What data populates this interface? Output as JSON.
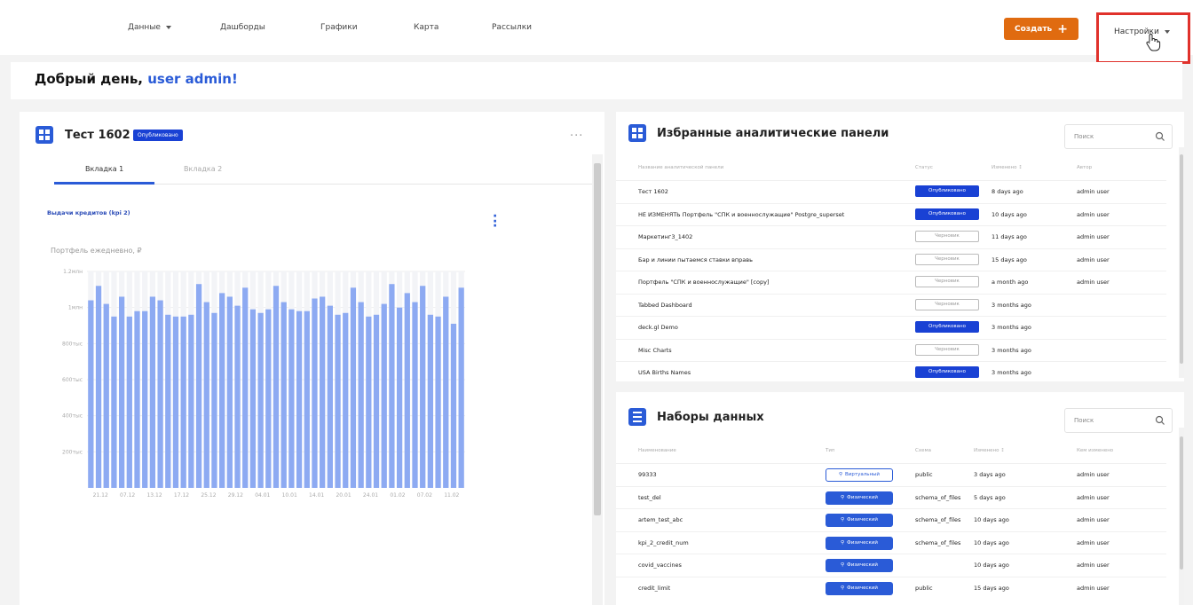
{
  "nav": {
    "items": [
      {
        "label": "Данные",
        "dropdown": true
      },
      {
        "label": "Дашборды"
      },
      {
        "label": "Графики"
      },
      {
        "label": "Карта"
      },
      {
        "label": "Рассылки"
      }
    ],
    "create_label": "Создать",
    "settings_label": "Настройки"
  },
  "greeting": {
    "prefix": "Добрый день,",
    "user": "user admin!"
  },
  "dashboard": {
    "title": "Тест 1602",
    "status": "Опубликовано",
    "more": "···",
    "tabs": [
      "Вкладка 1",
      "Вкладка 2"
    ],
    "chart_title": "Выдачи кредитов (kpi 2)",
    "chart_subtitle": "Портфель ежедневно, ₽"
  },
  "chart_data": {
    "type": "bar",
    "y_ticks": [
      "1.2млн",
      "1млн",
      "800тыс",
      "600тыс",
      "400тыс",
      "200тыс"
    ],
    "ylim": [
      0,
      1200000
    ],
    "x_ticks": [
      "21.12",
      "07.12",
      "13.12",
      "17.12",
      "25.12",
      "29.12",
      "04.01",
      "10.01",
      "14.01",
      "20.01",
      "24.01",
      "01.02",
      "07.02",
      "11.02"
    ],
    "values": [
      1040000,
      1120000,
      1020000,
      950000,
      1060000,
      950000,
      980000,
      980000,
      1060000,
      1040000,
      960000,
      950000,
      950000,
      960000,
      1130000,
      1030000,
      970000,
      1080000,
      1060000,
      1010000,
      1110000,
      990000,
      970000,
      990000,
      1120000,
      1030000,
      990000,
      980000,
      980000,
      1050000,
      1060000,
      1010000,
      960000,
      970000,
      1110000,
      1030000,
      950000,
      960000,
      1020000,
      1130000,
      1000000,
      1080000,
      1030000,
      1120000,
      960000,
      950000,
      1060000,
      910000,
      1110000
    ],
    "color": "#8daaf2",
    "grid": true
  },
  "favorites": {
    "title": "Избранные аналитические панели",
    "search_placeholder": "Поиск",
    "columns": [
      "Название аналитической панели",
      "Статус",
      "Изменено",
      "Автор"
    ],
    "sort_glyph": "↕",
    "rows": [
      {
        "name": "Тест 1602",
        "status": "Опубликовано",
        "published": true,
        "modified": "8 days ago",
        "author": "admin user"
      },
      {
        "name": "НЕ ИЗМЕНЯТЬ Портфель \"СПК и военнослужащие\" Postgre_superset",
        "status": "Опубликовано",
        "published": true,
        "modified": "10 days ago",
        "author": "admin user"
      },
      {
        "name": "Маркетинг3_1402",
        "status": "Черновик",
        "published": false,
        "modified": "11 days ago",
        "author": "admin user"
      },
      {
        "name": "Бар и линии пытаемся ставки вправь",
        "status": "Черновик",
        "published": false,
        "modified": "15 days ago",
        "author": "admin user"
      },
      {
        "name": "Портфель \"СПК и военнослужащие\" [copy]",
        "status": "Черновик",
        "published": false,
        "modified": "a month ago",
        "author": "admin user"
      },
      {
        "name": "Tabbed Dashboard",
        "status": "Черновик",
        "published": false,
        "modified": "3 months ago",
        "author": ""
      },
      {
        "name": "deck.gl Demo",
        "status": "Опубликовано",
        "published": true,
        "modified": "3 months ago",
        "author": ""
      },
      {
        "name": "Misc Charts",
        "status": "Черновик",
        "published": false,
        "modified": "3 months ago",
        "author": ""
      },
      {
        "name": "USA Births Names",
        "status": "Опубликовано",
        "published": true,
        "modified": "3 months ago",
        "author": ""
      }
    ]
  },
  "datasets": {
    "title": "Наборы данных",
    "search_placeholder": "Поиск",
    "columns": [
      "Наименование",
      "Тип",
      "Схема",
      "Изменено",
      "Кем изменено"
    ],
    "sort_glyph": "↕",
    "rows": [
      {
        "name": "99333",
        "type": "Виртуальный",
        "virtual": true,
        "schema": "public",
        "modified": "3 days ago",
        "by": "admin user"
      },
      {
        "name": "test_del",
        "type": "Физический",
        "virtual": false,
        "schema": "schema_of_files",
        "modified": "5 days ago",
        "by": "admin user"
      },
      {
        "name": "artem_test_abc",
        "type": "Физический",
        "virtual": false,
        "schema": "schema_of_files",
        "modified": "10 days ago",
        "by": "admin user"
      },
      {
        "name": "kpi_2_credit_num",
        "type": "Физический",
        "virtual": false,
        "schema": "schema_of_files",
        "modified": "10 days ago",
        "by": "admin user"
      },
      {
        "name": "covid_vaccines",
        "type": "Физический",
        "virtual": false,
        "schema": "",
        "modified": "10 days ago",
        "by": "admin user"
      },
      {
        "name": "credit_limit",
        "type": "Физический",
        "virtual": false,
        "schema": "public",
        "modified": "15 days ago",
        "by": "admin user"
      }
    ]
  }
}
